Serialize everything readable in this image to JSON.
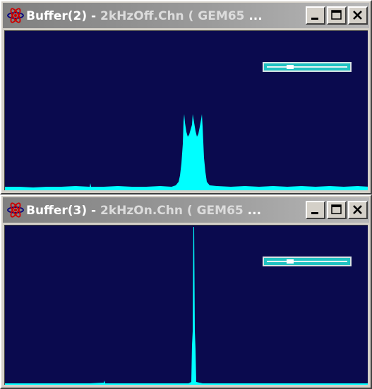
{
  "windows": [
    {
      "title_main": "Buffer(2)",
      "title_sep": " - ",
      "title_rest": "2kHzOff.Chn ( GEM65",
      "title_ellipsis": " ...",
      "icon": "radiation-icon",
      "buttons": [
        "minimize-icon",
        "maximize-icon",
        "close-icon"
      ]
    },
    {
      "title_main": "Buffer(3)",
      "title_sep": " - ",
      "title_rest": "2kHzOn.Chn ( GEM65",
      "title_ellipsis": " ...",
      "icon": "radiation-icon",
      "buttons": [
        "minimize-icon",
        "maximize-icon",
        "close-icon"
      ]
    }
  ],
  "colors": {
    "plot_background": "#0a0a4e",
    "spectrum": "#00ffff",
    "scrollbar": "#20c2c2",
    "titlebar_inactive": "#808080"
  }
}
